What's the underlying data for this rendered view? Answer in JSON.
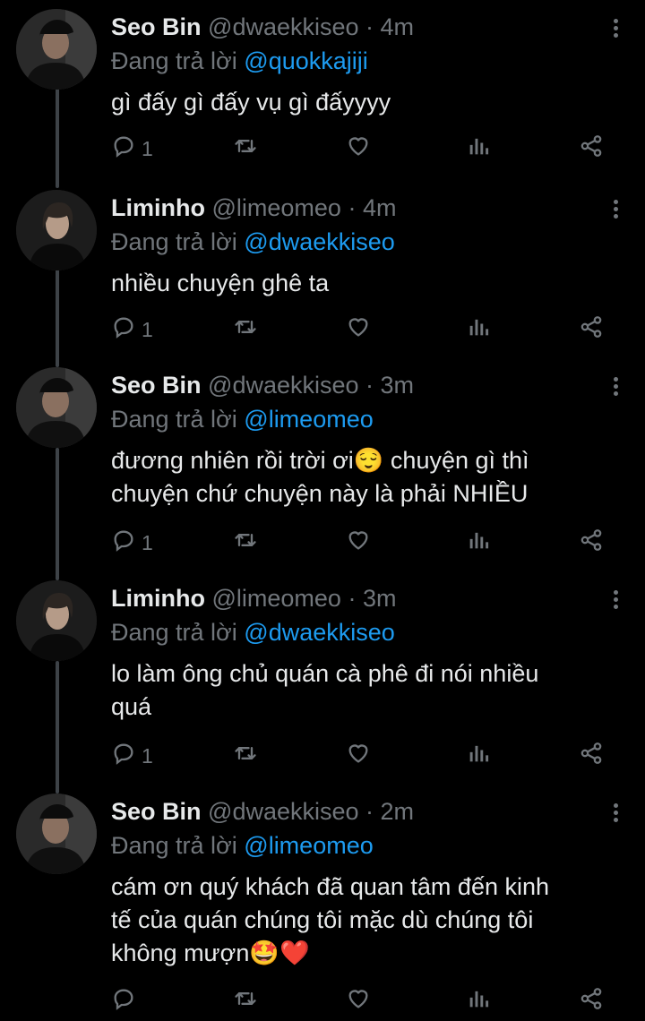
{
  "reply_prefix": "Đang trả lời",
  "colors": {
    "background": "#000000",
    "text": "#e7e9ea",
    "muted": "#71767b",
    "link": "#1d9bf0",
    "thread_line": "#3d4247"
  },
  "tweets": [
    {
      "name": "Seo Bin",
      "handle": "@dwaekkiseo",
      "time": "· 4m",
      "replying_to": "@quokkajiji",
      "lines": [
        "gì đấy gì đấy vụ gì đấyyyy"
      ],
      "reply_count": "1",
      "avatar": "dark-cap-avatar"
    },
    {
      "name": "Liminho",
      "handle": "@limeomeo",
      "time": "· 4m",
      "replying_to": "@dwaekkiseo",
      "lines": [
        "nhiều chuyện ghê ta"
      ],
      "reply_count": "1",
      "avatar": "long-hair-avatar"
    },
    {
      "name": "Seo Bin",
      "handle": "@dwaekkiseo",
      "time": "· 3m",
      "replying_to": "@limeomeo",
      "lines": [
        "đương nhiên rồi trời ơi😌 chuyện gì thì",
        "chuyện chứ chuyện này là phải NHIỀU"
      ],
      "reply_count": "1",
      "avatar": "dark-cap-avatar"
    },
    {
      "name": "Liminho",
      "handle": "@limeomeo",
      "time": "· 3m",
      "replying_to": "@dwaekkiseo",
      "lines": [
        "lo làm ông chủ quán cà phê đi nói nhiều",
        "quá"
      ],
      "reply_count": "1",
      "avatar": "long-hair-avatar"
    },
    {
      "name": "Seo Bin",
      "handle": "@dwaekkiseo",
      "time": "· 2m",
      "replying_to": "@limeomeo",
      "lines": [
        "cám ơn quý khách đã quan tâm đến kinh",
        "tế của quán chúng tôi mặc dù chúng tôi",
        "không mượn🤩❤️"
      ],
      "reply_count": "",
      "avatar": "dark-cap-avatar"
    }
  ],
  "action_icons": [
    "reply-icon",
    "retweet-icon",
    "like-icon",
    "analytics-icon",
    "share-icon"
  ]
}
